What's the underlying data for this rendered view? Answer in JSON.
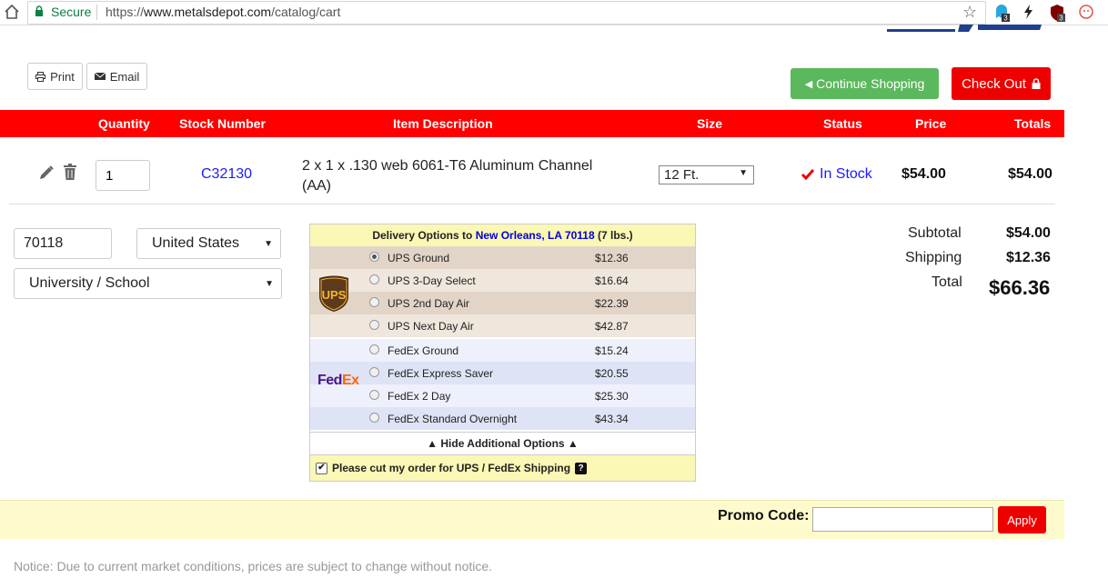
{
  "browser": {
    "secure_label": "Secure",
    "url_scheme": "https://",
    "url_host": "www.metalsdepot.com",
    "url_path": "/catalog/cart",
    "ext_badge_1": "3",
    "ext_badge_3": "3"
  },
  "toolbar": {
    "print_label": "Print",
    "email_label": "Email",
    "continue_label": "Continue Shopping",
    "checkout_label": "Check Out"
  },
  "table_headers": {
    "quantity": "Quantity",
    "stock_number": "Stock Number",
    "item_description": "Item Description",
    "size": "Size",
    "status": "Status",
    "price": "Price",
    "totals": "Totals"
  },
  "cart_item": {
    "quantity": "1",
    "stock_number": "C32130",
    "description": "2 x 1 x .130 web 6061-T6 Aluminum Channel (AA)",
    "size": "12 Ft.",
    "status": "In Stock",
    "price": "$54.00",
    "total": "$54.00"
  },
  "shipping_form": {
    "zip": "70118",
    "country": "United States",
    "address_type": "University / School"
  },
  "delivery": {
    "prefix": "Delivery Options to",
    "location": "New Orleans, LA 70118",
    "weight": "(7 lbs.)",
    "ups_logo": "UPS",
    "fedex_logo_fed": "Fed",
    "fedex_logo_ex": "Ex",
    "options": [
      {
        "carrier": "ups",
        "label": "UPS Ground",
        "price": "$12.36",
        "selected": true
      },
      {
        "carrier": "ups",
        "label": "UPS 3-Day Select",
        "price": "$16.64",
        "selected": false
      },
      {
        "carrier": "ups",
        "label": "UPS 2nd Day Air",
        "price": "$22.39",
        "selected": false
      },
      {
        "carrier": "ups",
        "label": "UPS Next Day Air",
        "price": "$42.87",
        "selected": false
      },
      {
        "carrier": "fedex",
        "label": "FedEx Ground",
        "price": "$15.24",
        "selected": false
      },
      {
        "carrier": "fedex",
        "label": "FedEx Express Saver",
        "price": "$20.55",
        "selected": false
      },
      {
        "carrier": "fedex",
        "label": "FedEx 2 Day",
        "price": "$25.30",
        "selected": false
      },
      {
        "carrier": "fedex",
        "label": "FedEx Standard Overnight",
        "price": "$43.34",
        "selected": false
      }
    ],
    "hide_label": "▲ Hide Additional Options ▲",
    "cut_label": "Please cut my order for UPS / FedEx Shipping",
    "cut_checked": true,
    "help_glyph": "?"
  },
  "summary": {
    "subtotal_label": "Subtotal",
    "subtotal": "$54.00",
    "shipping_label": "Shipping",
    "shipping": "$12.36",
    "total_label": "Total",
    "total": "$66.36"
  },
  "promo": {
    "label": "Promo Code:",
    "value": "",
    "apply_label": "Apply"
  },
  "notice": "Notice: Due to current market conditions, prices are subject to change without notice.",
  "colors": {
    "header_red": "#ff0000",
    "button_red": "#ee0000",
    "continue_green": "#5cb85c",
    "link_blue": "#1a1aff",
    "promo_yellow": "#fdfbcc"
  }
}
